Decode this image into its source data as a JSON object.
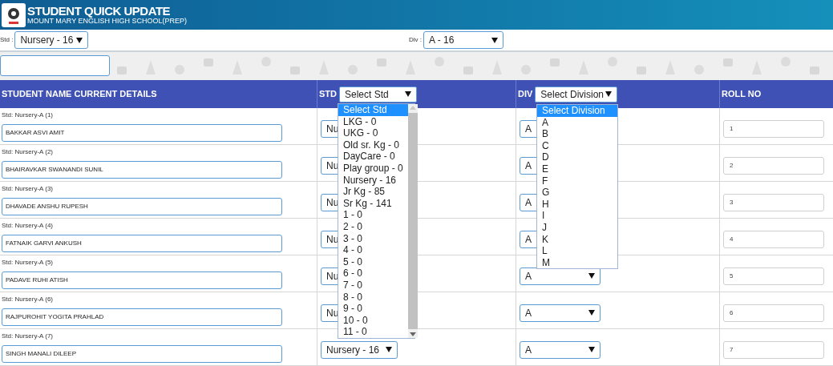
{
  "header": {
    "title": "STUDENT QUICK UPDATE",
    "subtitle": "MOUNT MARY ENGLISH HIGH SCHOOL(PREP)"
  },
  "filters": [
    {
      "label": "Std :",
      "value": "Nursery - 16"
    },
    {
      "label": "Div :",
      "value": "A - 16"
    }
  ],
  "table": {
    "columns": [
      {
        "label": "STUDENT NAME CURRENT DETAILS"
      },
      {
        "label": "STD",
        "select": "Select Std"
      },
      {
        "label": "DIV",
        "select": "Select Division"
      },
      {
        "label": "ROLL NO"
      }
    ],
    "rows": [
      {
        "details": "Std: Nursery-A (1)",
        "name": "BAKKAR ASVI AMIT",
        "std": "Nu",
        "div": "A",
        "roll": "1"
      },
      {
        "details": "Std: Nursery-A (2)",
        "name": "BHAIRAVKAR SWANANDI SUNIL",
        "std": "Nu",
        "div": "A",
        "roll": "2"
      },
      {
        "details": "Std: Nursery-A (3)",
        "name": "DHAVADE ANSHU RUPESH",
        "std": "Nu",
        "div": "A",
        "roll": "3"
      },
      {
        "details": "Std: Nursery-A (4)",
        "name": "FATNAIK GARVI ANKUSH",
        "std": "Nu",
        "div": "A",
        "roll": "4"
      },
      {
        "details": "Std: Nursery-A (5)",
        "name": "PADAVE RUHI ATISH",
        "std": "Nu",
        "div": "A",
        "roll": "5"
      },
      {
        "details": "Std: Nursery-A (6)",
        "name": "RAJPUROHIT YOGITA PRAHLAD",
        "std": "Nu",
        "div": "A",
        "roll": "6"
      },
      {
        "details": "Std: Nursery-A (7)",
        "name": "SINGH MANALI DILEEP",
        "std": "Nursery - 16",
        "div": "A",
        "roll": "7"
      }
    ]
  },
  "std_dropdown": {
    "options": [
      {
        "label": "Select Std",
        "selected": true
      },
      {
        "label": "LKG - 0",
        "selected": false
      },
      {
        "label": "UKG - 0",
        "selected": false
      },
      {
        "label": "Old sr. Kg - 0",
        "selected": false
      },
      {
        "label": "DayCare - 0",
        "selected": false
      },
      {
        "label": "Play group - 0",
        "selected": false
      },
      {
        "label": "Nursery - 16",
        "selected": false
      },
      {
        "label": "Jr Kg - 85",
        "selected": false
      },
      {
        "label": "Sr Kg - 141",
        "selected": false
      },
      {
        "label": "1 - 0",
        "selected": false
      },
      {
        "label": "2 - 0",
        "selected": false
      },
      {
        "label": "3 - 0",
        "selected": false
      },
      {
        "label": "4 - 0",
        "selected": false
      },
      {
        "label": "5 - 0",
        "selected": false
      },
      {
        "label": "6 - 0",
        "selected": false
      },
      {
        "label": "7 - 0",
        "selected": false
      },
      {
        "label": "8 - 0",
        "selected": false
      },
      {
        "label": "9 - 0",
        "selected": false
      },
      {
        "label": "10 - 0",
        "selected": false
      },
      {
        "label": "11 - 0",
        "selected": false
      }
    ]
  },
  "div_dropdown": {
    "options": [
      {
        "label": "Select Division",
        "selected": true
      },
      {
        "label": "A",
        "selected": false
      },
      {
        "label": "B",
        "selected": false
      },
      {
        "label": "C",
        "selected": false
      },
      {
        "label": "D",
        "selected": false
      },
      {
        "label": "E",
        "selected": false
      },
      {
        "label": "F",
        "selected": false
      },
      {
        "label": "G",
        "selected": false
      },
      {
        "label": "H",
        "selected": false
      },
      {
        "label": "I",
        "selected": false
      },
      {
        "label": "J",
        "selected": false
      },
      {
        "label": "K",
        "selected": false
      },
      {
        "label": "L",
        "selected": false
      },
      {
        "label": "M",
        "selected": false
      }
    ]
  }
}
